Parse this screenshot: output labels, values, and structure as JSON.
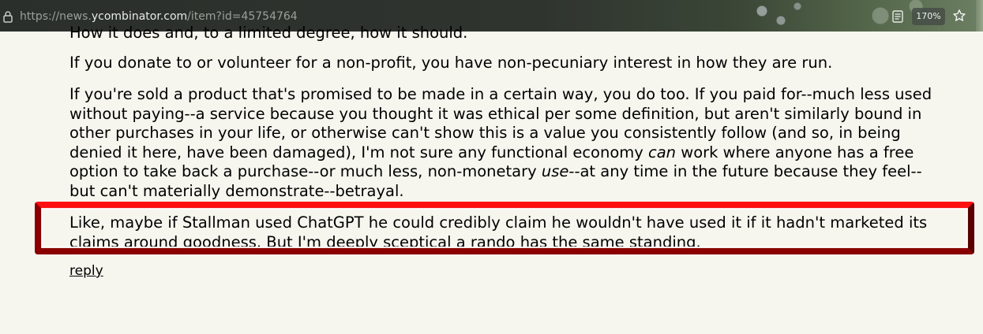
{
  "browser": {
    "url_prefix": "https://news.",
    "url_host": "ycombinator.com",
    "url_path": "/item?id=45754764",
    "zoom_label": "170%",
    "icons": [
      "lock-icon",
      "reader-view-icon",
      "bookmark-star-icon"
    ]
  },
  "comment": {
    "p0": "How it does and, to a limited degree, how it should.",
    "p1": "If you donate to or volunteer for a non-profit, you have non-pecuniary interest in how they are run.",
    "p2_l1": "If you're sold a product that's promised to be made in a certain way, you do too. If you paid for--much less used",
    "p2_l2": "without paying--a service because you thought it was ethical per some definition, but aren't similarly bound in",
    "p2_l3": "other purchases in your life, or otherwise can't show this is a value you consistently follow (and so, in being",
    "p2_l4_a": "denied it here, have been damaged), I'm not sure any functional economy ",
    "p2_l4_em": "can",
    "p2_l4_b": " work where anyone has a free",
    "p2_l5_a": "option to take back a purchase--or much less, non-monetary ",
    "p2_l5_em": "use",
    "p2_l5_b": "--at any time in the future because they feel--",
    "p2_l6": "but can't materially demonstrate--betrayal.",
    "p3_l1": "Like, maybe if Stallman used ChatGPT he could credibly claim he wouldn't have used it if it hadn't marketed its",
    "p3_l2": "claims around goodness. But I'm deeply sceptical a rando has the same standing.",
    "reply_label": "reply"
  },
  "colors": {
    "page_background": "#f6f6ef",
    "highlight": "#cc0000"
  }
}
